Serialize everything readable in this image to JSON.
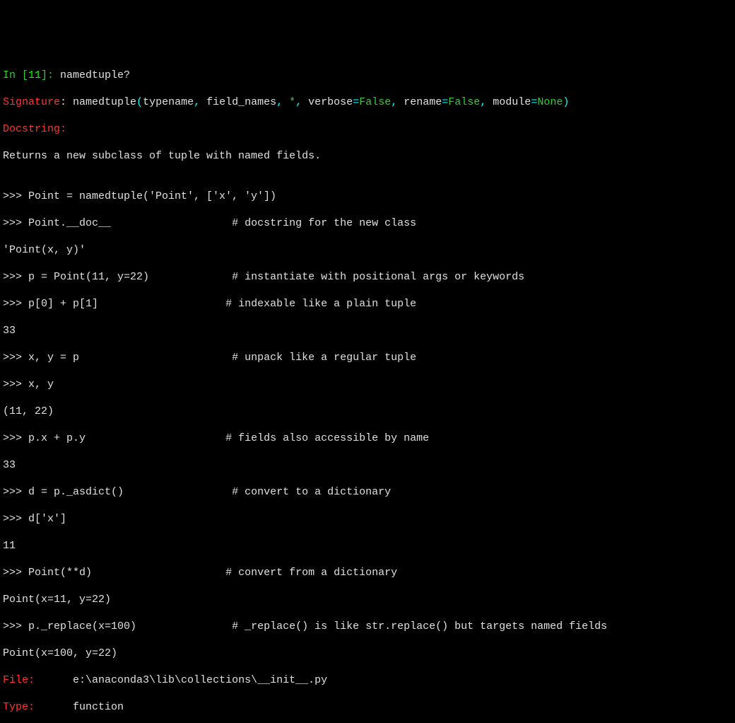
{
  "lines": {
    "l1": {
      "in_label": "In [",
      "in_num": "11",
      "in_close": "]: ",
      "cmd": "namedtuple?"
    },
    "sig": {
      "label": "Signature",
      "colon": ": ",
      "fn": "namedtuple",
      "open": "(",
      "p1": "typename",
      "c1": ", ",
      "p2": "field_names",
      "c2": ", ",
      "star": "*",
      "c3": ", ",
      "p3": "verbose",
      "eq1": "=",
      "v1": "False",
      "c4": ", ",
      "p4": "rename",
      "eq2": "=",
      "v2": "False",
      "c5": ", ",
      "p5": "module",
      "eq3": "=",
      "v3": "None",
      "close": ")"
    },
    "docstring_label": "Docstring:",
    "returns": "Returns a new subclass of tuple with named fields.",
    "blank": "",
    "ex1": ">>> Point = namedtuple('Point', ['x', 'y'])",
    "ex2a": ">>> Point.__doc__",
    "ex2b": "# docstring for the new class",
    "ex3": "'Point(x, y)'",
    "ex4a": ">>> p = Point(11, y=22)",
    "ex4b": "# instantiate with positional args or keywords",
    "ex5a": ">>> p[0] + p[1]",
    "ex5b": "# indexable like a plain tuple",
    "ex6": "33",
    "ex7a": ">>> x, y = p",
    "ex7b": "# unpack like a regular tuple",
    "ex8": ">>> x, y",
    "ex9": "(11, 22)",
    "ex10a": ">>> p.x + p.y",
    "ex10b": "# fields also accessible by name",
    "ex11": "33",
    "ex12a": ">>> d = p._asdict()",
    "ex12b": "# convert to a dictionary",
    "ex13": ">>> d['x']",
    "ex14": "11",
    "ex15a": ">>> Point(**d)",
    "ex15b": "# convert from a dictionary",
    "ex16": "Point(x=11, y=22)",
    "ex17a": ">>> p._replace(x=100)",
    "ex17b": "# _replace() is like str.replace() but targets named fields",
    "ex18": "Point(x=100, y=22)",
    "file": {
      "label": "File:",
      "pad": "      ",
      "path": "e:\\anaconda3\\lib\\collections\\__init__.py"
    },
    "type": {
      "label": "Type:",
      "pad": "      ",
      "value": "function"
    }
  },
  "pad": {
    "ex2": "                   ",
    "ex4": "             ",
    "ex5": "                    ",
    "ex7": "                        ",
    "ex10": "                      ",
    "ex12": "                 ",
    "ex15": "                     ",
    "ex17": "               "
  }
}
